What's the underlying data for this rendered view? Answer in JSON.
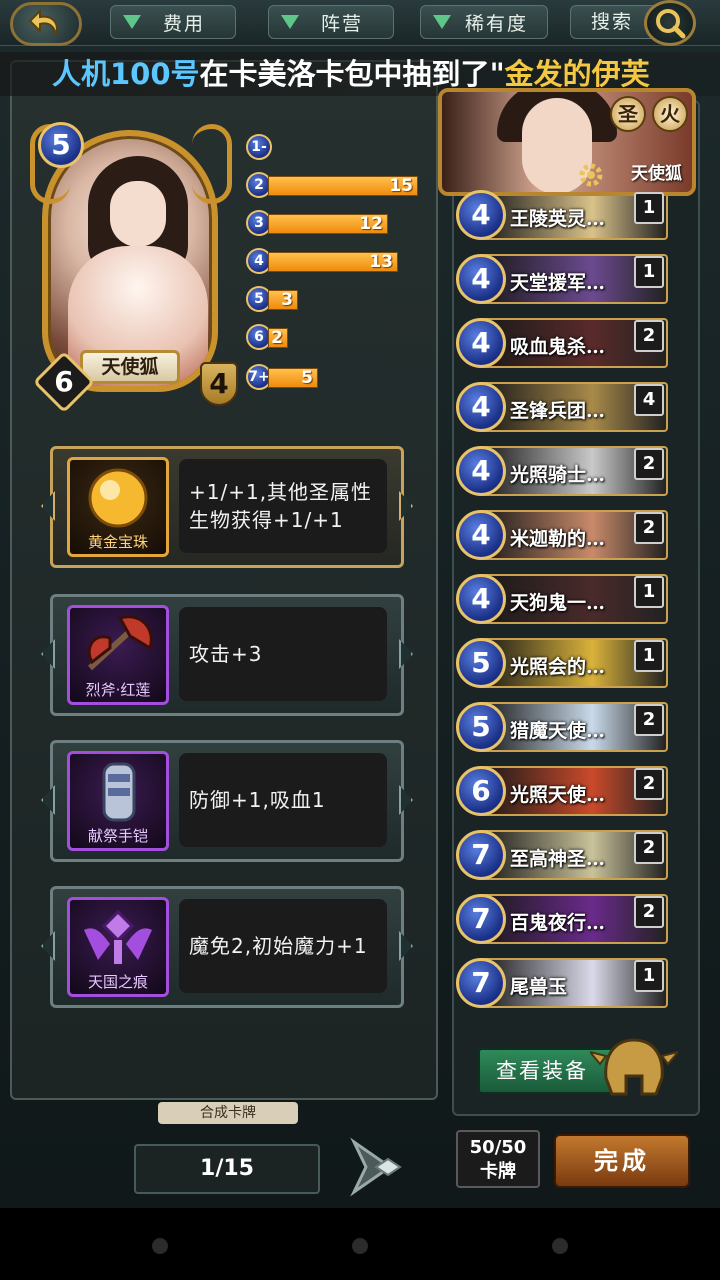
{
  "topbar": {
    "filters": [
      {
        "label": "费用"
      },
      {
        "label": "阵营"
      },
      {
        "label": "稀有度"
      }
    ],
    "search_label": "搜索"
  },
  "broadcast": {
    "player": "人机100号",
    "middle": "在卡美洛卡包中抽到了",
    "quote": "\"",
    "card": "金发的伊芙"
  },
  "card": {
    "name": "天使狐",
    "cost": "5",
    "attack": "6",
    "defense": "4"
  },
  "cost_histogram": [
    {
      "cost": "1-",
      "count": 0,
      "label": ""
    },
    {
      "cost": "2",
      "count": 15,
      "label": "15"
    },
    {
      "cost": "3",
      "count": 12,
      "label": "12"
    },
    {
      "cost": "4",
      "count": 13,
      "label": "13"
    },
    {
      "cost": "5",
      "count": 3,
      "label": "3"
    },
    {
      "cost": "6",
      "count": 2,
      "label": "2"
    },
    {
      "cost": "7+",
      "count": 5,
      "label": "5"
    }
  ],
  "equipment": [
    {
      "name": "黄金宝珠",
      "desc": "+1/+1,其他圣属性生物获得+1/+1",
      "rarity": "gold"
    },
    {
      "name": "烈斧·红莲",
      "desc": "攻击+3",
      "rarity": "purple"
    },
    {
      "name": "献祭手铠",
      "desc": "防御+1,吸血1",
      "rarity": "purple"
    },
    {
      "name": "天国之痕",
      "desc": "魔免2,初始魔力+1",
      "rarity": "purple"
    }
  ],
  "compose_label": "合成卡牌",
  "page_indicator": "1/15",
  "hero": {
    "name": "天使狐",
    "badges": [
      "圣",
      "火"
    ]
  },
  "deck": [
    {
      "cost": "4",
      "name": "王陵英灵…",
      "count": "1",
      "color": "#d9c28a"
    },
    {
      "cost": "4",
      "name": "天堂援军…",
      "count": "1",
      "color": "#6b4a8f"
    },
    {
      "cost": "4",
      "name": "吸血鬼杀…",
      "count": "2",
      "color": "#5a2a2a"
    },
    {
      "cost": "4",
      "name": "圣锋兵团…",
      "count": "4",
      "color": "#a88a4a"
    },
    {
      "cost": "4",
      "name": "光照骑士…",
      "count": "2",
      "color": "#c9c9c9"
    },
    {
      "cost": "4",
      "name": "米迦勒的…",
      "count": "2",
      "color": "#c98a6a"
    },
    {
      "cost": "4",
      "name": "天狗鬼一…",
      "count": "1",
      "color": "#4a2a2a"
    },
    {
      "cost": "5",
      "name": "光照会的…",
      "count": "1",
      "color": "#d9b23a"
    },
    {
      "cost": "5",
      "name": "猎魔天使…",
      "count": "2",
      "color": "#c9d9e9"
    },
    {
      "cost": "6",
      "name": "光照天使…",
      "count": "2",
      "color": "#c94a2a"
    },
    {
      "cost": "7",
      "name": "至高神圣…",
      "count": "2",
      "color": "#c9c29a"
    },
    {
      "cost": "7",
      "name": "百鬼夜行…",
      "count": "2",
      "color": "#6a2a8a"
    },
    {
      "cost": "7",
      "name": "尾兽玉",
      "count": "1",
      "color": "#d9d9e9"
    }
  ],
  "view_equip_label": "查看装备",
  "card_count": {
    "value": "50/50",
    "label": "卡牌"
  },
  "done_label": "完成"
}
